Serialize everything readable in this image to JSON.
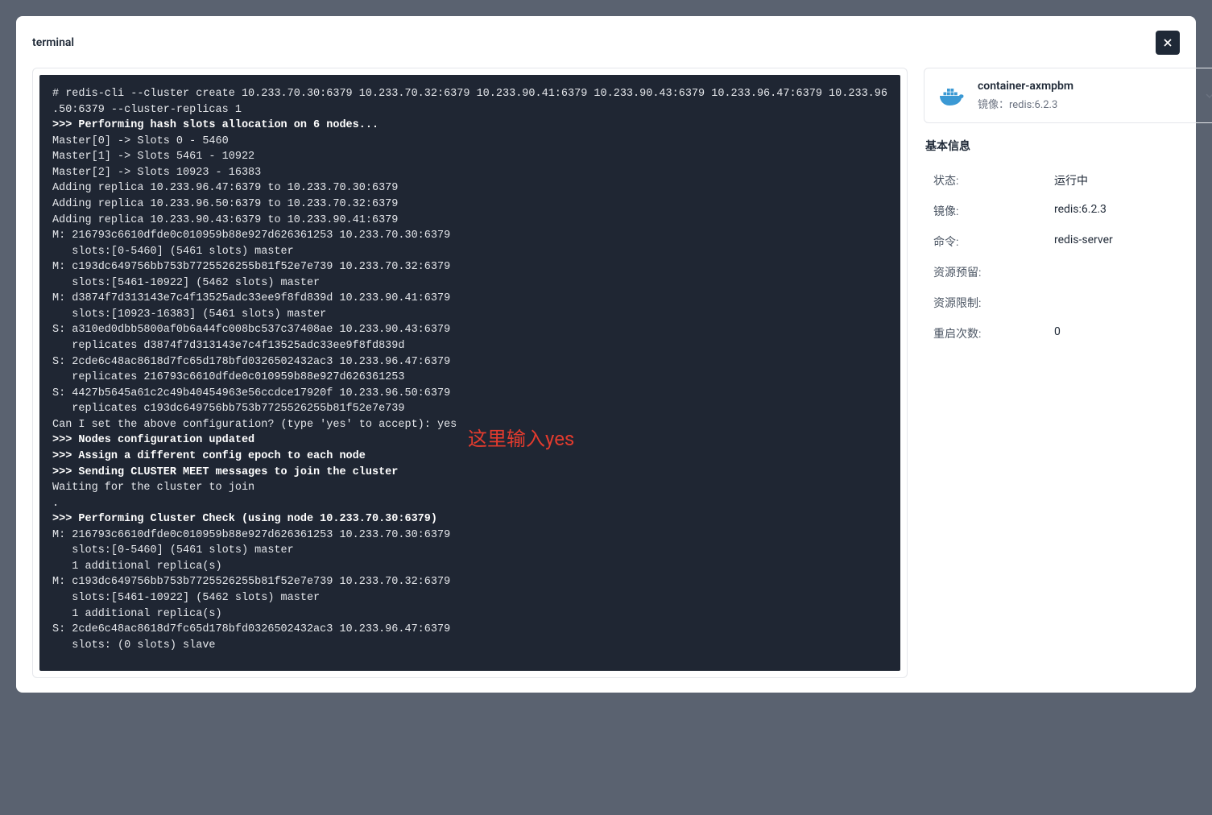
{
  "modal": {
    "title": "terminal"
  },
  "annotation": "这里输入yes",
  "terminal": {
    "lines": [
      {
        "t": "# redis-cli --cluster create 10.233.70.30:6379 10.233.70.32:6379 10.233.90.41:6379 10.233.90.43:6379 10.233.96.47:6379 10.233.96.50:6379 --cluster-replicas 1",
        "b": false,
        "wrap": true,
        "wrapAt": 128
      },
      {
        "t": ">>> Performing hash slots allocation on 6 nodes...",
        "b": true
      },
      {
        "t": "Master[0] -> Slots 0 - 5460",
        "b": false
      },
      {
        "t": "Master[1] -> Slots 5461 - 10922",
        "b": false
      },
      {
        "t": "Master[2] -> Slots 10923 - 16383",
        "b": false
      },
      {
        "t": "Adding replica 10.233.96.47:6379 to 10.233.70.30:6379",
        "b": false
      },
      {
        "t": "Adding replica 10.233.96.50:6379 to 10.233.70.32:6379",
        "b": false
      },
      {
        "t": "Adding replica 10.233.90.43:6379 to 10.233.90.41:6379",
        "b": false
      },
      {
        "t": "M: 216793c6610dfde0c010959b88e927d626361253 10.233.70.30:6379",
        "b": false
      },
      {
        "t": "   slots:[0-5460] (5461 slots) master",
        "b": false
      },
      {
        "t": "M: c193dc649756bb753b7725526255b81f52e7e739 10.233.70.32:6379",
        "b": false
      },
      {
        "t": "   slots:[5461-10922] (5462 slots) master",
        "b": false
      },
      {
        "t": "M: d3874f7d313143e7c4f13525adc33ee9f8fd839d 10.233.90.41:6379",
        "b": false
      },
      {
        "t": "   slots:[10923-16383] (5461 slots) master",
        "b": false
      },
      {
        "t": "S: a310ed0dbb5800af0b6a44fc008bc537c37408ae 10.233.90.43:6379",
        "b": false
      },
      {
        "t": "   replicates d3874f7d313143e7c4f13525adc33ee9f8fd839d",
        "b": false
      },
      {
        "t": "S: 2cde6c48ac8618d7fc65d178bfd0326502432ac3 10.233.96.47:6379",
        "b": false
      },
      {
        "t": "   replicates 216793c6610dfde0c010959b88e927d626361253",
        "b": false
      },
      {
        "t": "S: 4427b5645a61c2c49b40454963e56ccdce17920f 10.233.96.50:6379",
        "b": false
      },
      {
        "t": "   replicates c193dc649756bb753b7725526255b81f52e7e739",
        "b": false
      },
      {
        "t": "Can I set the above configuration? (type 'yes' to accept): yes",
        "b": false
      },
      {
        "t": ">>> Nodes configuration updated",
        "b": true
      },
      {
        "t": ">>> Assign a different config epoch to each node",
        "b": true
      },
      {
        "t": ">>> Sending CLUSTER MEET messages to join the cluster",
        "b": true
      },
      {
        "t": "Waiting for the cluster to join",
        "b": false
      },
      {
        "t": ".",
        "b": false
      },
      {
        "t": ">>> Performing Cluster Check (using node 10.233.70.30:6379)",
        "b": true
      },
      {
        "t": "M: 216793c6610dfde0c010959b88e927d626361253 10.233.70.30:6379",
        "b": false
      },
      {
        "t": "   slots:[0-5460] (5461 slots) master",
        "b": false
      },
      {
        "t": "   1 additional replica(s)",
        "b": false
      },
      {
        "t": "M: c193dc649756bb753b7725526255b81f52e7e739 10.233.70.32:6379",
        "b": false
      },
      {
        "t": "   slots:[5461-10922] (5462 slots) master",
        "b": false
      },
      {
        "t": "   1 additional replica(s)",
        "b": false
      },
      {
        "t": "S: 2cde6c48ac8618d7fc65d178bfd0326502432ac3 10.233.96.47:6379",
        "b": false
      },
      {
        "t": "   slots: (0 slots) slave",
        "b": false
      }
    ]
  },
  "container": {
    "name": "container-axmpbm",
    "image_prefix": "镜像：",
    "image": "redis:6.2.3"
  },
  "section": {
    "title": "基本信息"
  },
  "info": [
    {
      "label": "状态:",
      "value": "运行中"
    },
    {
      "label": "镜像:",
      "value": "redis:6.2.3"
    },
    {
      "label": "命令:",
      "value": "redis-server"
    },
    {
      "label": "资源预留:",
      "value": ""
    },
    {
      "label": "资源限制:",
      "value": ""
    },
    {
      "label": "重启次数:",
      "value": "0"
    }
  ]
}
